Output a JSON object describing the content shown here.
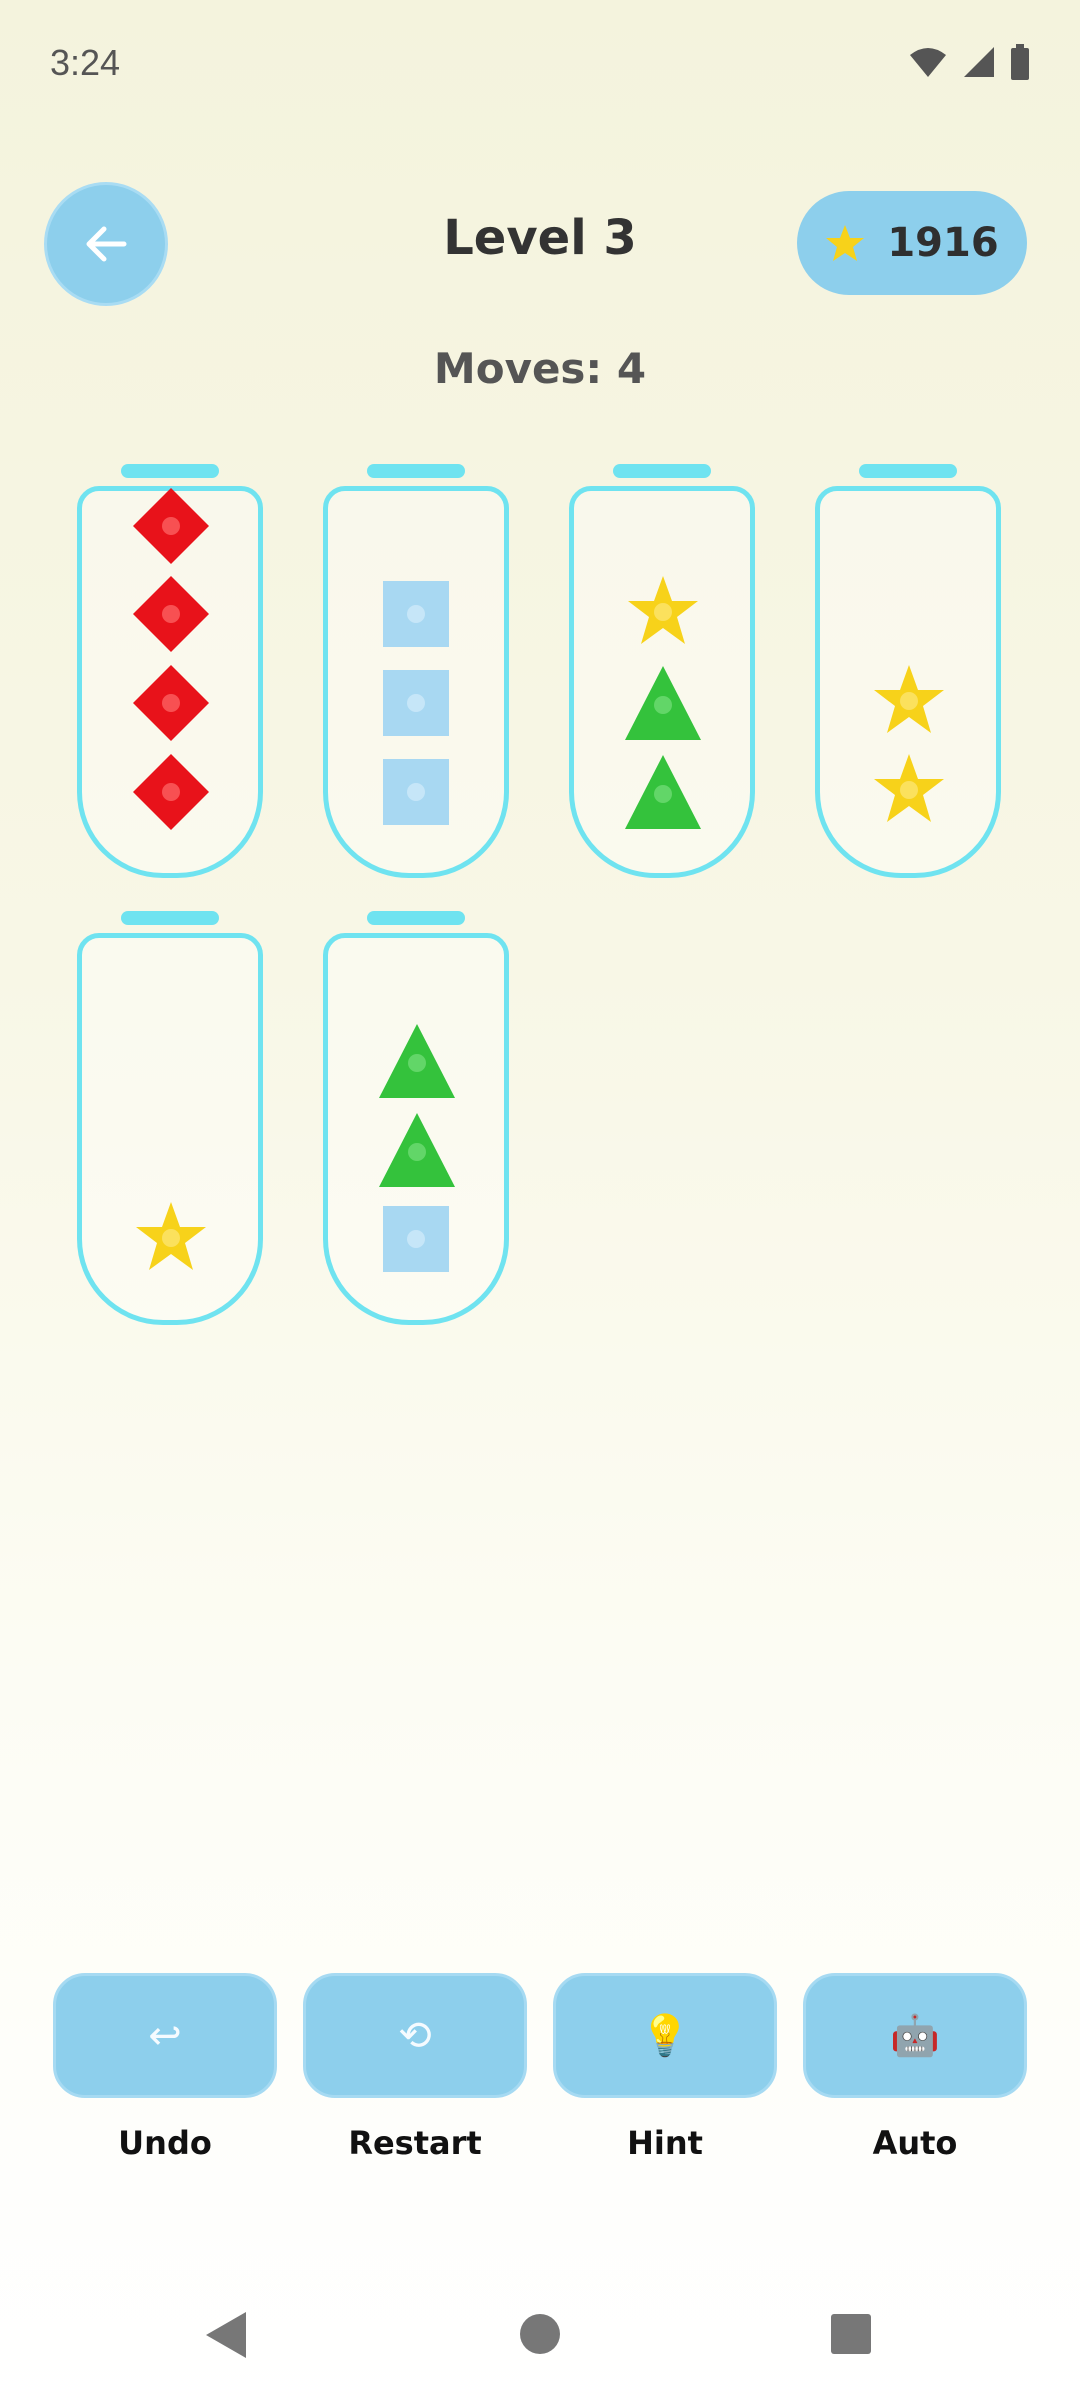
{
  "status_bar": {
    "time": "3:24"
  },
  "header": {
    "title": "Level 3",
    "coins": "1916"
  },
  "moves_text": "Moves: 4",
  "tubes": [
    {
      "contents_top_to_bottom": [
        "red-diamond",
        "red-diamond",
        "red-diamond",
        "red-diamond"
      ]
    },
    {
      "contents_top_to_bottom": [
        "blue-square",
        "blue-square",
        "blue-square"
      ]
    },
    {
      "contents_top_to_bottom": [
        "yellow-star",
        "green-triangle",
        "green-triangle"
      ]
    },
    {
      "contents_top_to_bottom": [
        "yellow-star",
        "yellow-star"
      ]
    },
    {
      "contents_top_to_bottom": [
        "yellow-star"
      ]
    },
    {
      "contents_top_to_bottom": [
        "green-triangle",
        "green-triangle",
        "blue-square"
      ]
    }
  ],
  "actions": [
    {
      "label": "Undo",
      "icon": "↩",
      "icon_name": "undo-icon"
    },
    {
      "label": "Restart",
      "icon": "⟲",
      "icon_name": "restart-icon"
    },
    {
      "label": "Hint",
      "icon": "💡",
      "icon_name": "lightbulb-icon"
    },
    {
      "label": "Auto",
      "icon": "🤖",
      "icon_name": "robot-icon"
    }
  ],
  "colors": {
    "button": "#8dcfec",
    "tube_outline": "#6fe3f0",
    "diamond": "#e8121a",
    "square": "#a8d8f2",
    "triangle": "#34c23c",
    "star": "#f7d21a"
  }
}
